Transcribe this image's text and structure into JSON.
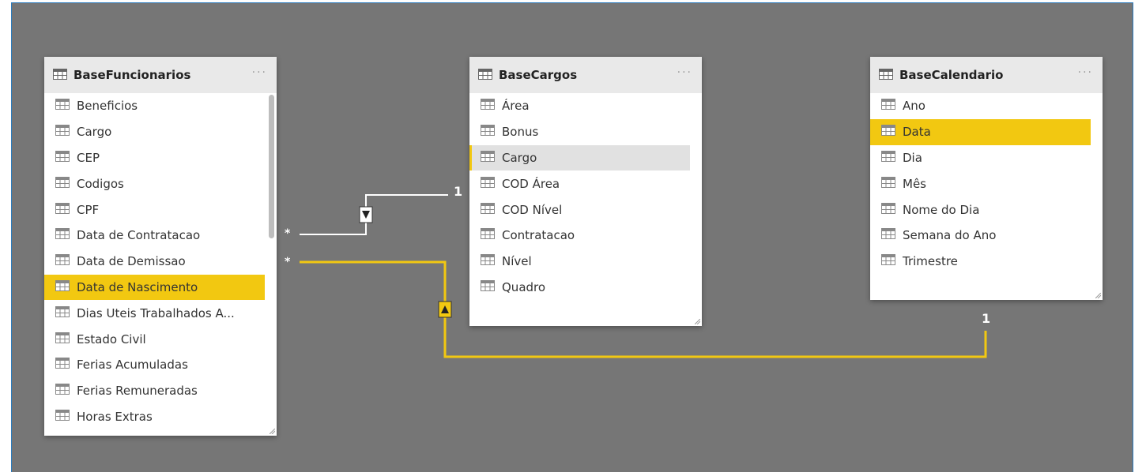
{
  "tables": [
    {
      "title": "BaseFuncionarios",
      "more": "···",
      "fields": [
        "Beneficios",
        "Cargo",
        "CEP",
        "Codigos",
        "CPF",
        "Data de Contratacao",
        "Data de Demissao",
        "Data de Nascimento",
        "Dias Uteis Trabalhados A...",
        "Estado Civil",
        "Ferias Acumuladas",
        "Ferias Remuneradas",
        "Horas Extras"
      ],
      "highlighted_field": "Data de Nascimento"
    },
    {
      "title": "BaseCargos",
      "more": "···",
      "fields": [
        "Área",
        "Bonus",
        "Cargo",
        "COD Área",
        "COD Nível",
        "Contratacao",
        "Nível",
        "Quadro"
      ],
      "selected_field": "Cargo"
    },
    {
      "title": "BaseCalendario",
      "more": "···",
      "fields": [
        "Ano",
        "Data",
        "Dia",
        "Mês",
        "Nome do Dia",
        "Semana do Ano",
        "Trimestre"
      ],
      "highlighted_field": "Data"
    }
  ],
  "relationships": [
    {
      "from": "BaseFuncionarios",
      "to": "BaseCargos",
      "many_label": "*",
      "one_label": "1",
      "color": "#ffffff",
      "active": false
    },
    {
      "from": "BaseFuncionarios",
      "to": "BaseCalendario",
      "many_label": "*",
      "one_label": "1",
      "color": "#f2c811",
      "active": true
    }
  ],
  "colors": {
    "canvas": "#767676",
    "highlight": "#f2c811",
    "header": "#e9e9e9"
  },
  "icon": "table-icon"
}
